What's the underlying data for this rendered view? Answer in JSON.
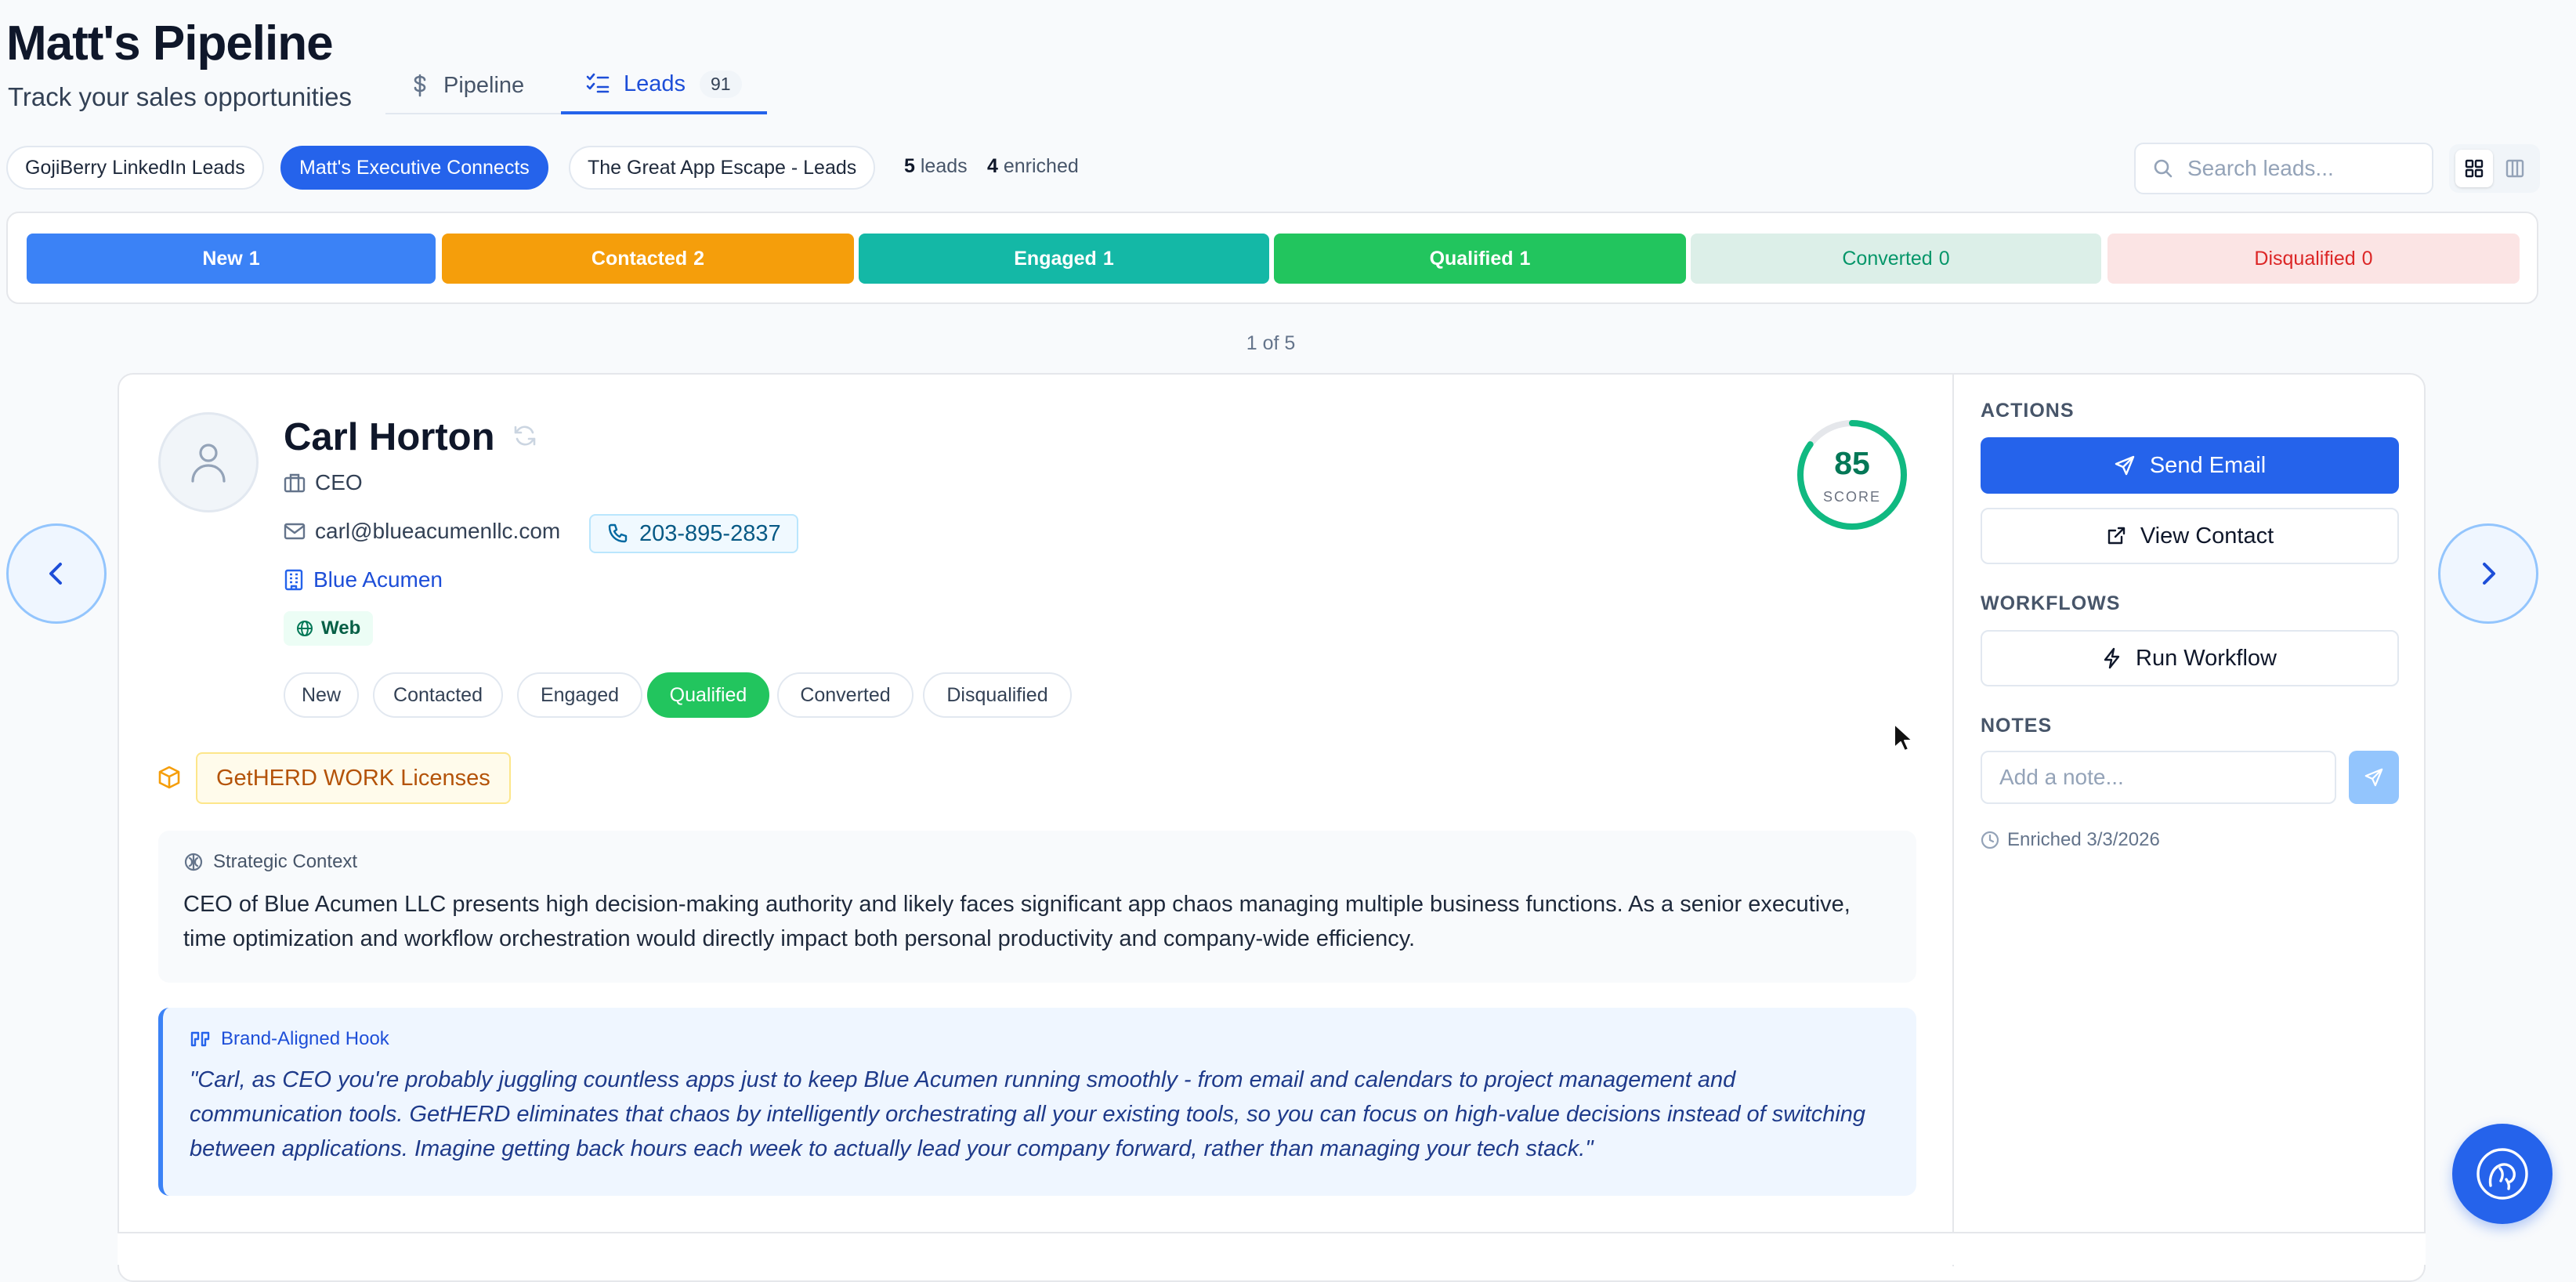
{
  "header": {
    "title": "Matt's Pipeline",
    "subtitle": "Track your sales opportunities",
    "tabs": [
      {
        "label": "Pipeline",
        "icon": "dollar-icon"
      },
      {
        "label": "Leads",
        "icon": "list-check-icon",
        "badge": "91"
      }
    ]
  },
  "filters": {
    "chips": [
      "GojiBerry LinkedIn Leads",
      "Matt's Executive Connects",
      "The Great App Escape - Leads"
    ],
    "active_chip": "Matt's Executive Connects",
    "leads_count": "5",
    "leads_label": "leads",
    "enriched_count": "4",
    "enriched_label": "enriched",
    "search_placeholder": "Search leads..."
  },
  "stages": [
    {
      "label": "New",
      "count": "1",
      "color": "#3b82f6"
    },
    {
      "label": "Contacted",
      "count": "2",
      "color": "#f59e0b"
    },
    {
      "label": "Engaged",
      "count": "1",
      "color": "#14b8a6"
    },
    {
      "label": "Qualified",
      "count": "1",
      "color": "#22c55e"
    },
    {
      "label": "Converted",
      "count": "0",
      "color": "#dcefe8"
    },
    {
      "label": "Disqualified",
      "count": "0",
      "color": "#fbe4e4"
    }
  ],
  "pagination": "1 of 5",
  "lead": {
    "name": "Carl Horton",
    "title": "CEO",
    "email": "carl@blueacumenllc.com",
    "phone": "203-895-2837",
    "company": "Blue Acumen",
    "source": "Web",
    "score": "85",
    "score_label": "SCORE",
    "score_fraction": 0.85,
    "status_options": [
      "New",
      "Contacted",
      "Engaged",
      "Qualified",
      "Converted",
      "Disqualified"
    ],
    "current_status": "Qualified",
    "product": "GetHERD WORK Licenses",
    "strategic_context_title": "Strategic Context",
    "strategic_context": "CEO of Blue Acumen LLC presents high decision-making authority and likely faces significant app chaos managing multiple business functions. As a senior executive, time optimization and workflow orchestration would directly impact both personal productivity and company-wide efficiency.",
    "hook_title": "Brand-Aligned Hook",
    "hook": "\"Carl, as CEO you're probably juggling countless apps just to keep Blue Acumen running smoothly - from email and calendars to project management and communication tools. GetHERD eliminates that chaos by intelligently orchestrating all your existing tools, so you can focus on high-value decisions instead of switching between applications. Imagine getting back hours each week to actually lead your company forward, rather than managing your tech stack.\""
  },
  "panel": {
    "actions_label": "ACTIONS",
    "send_email": "Send Email",
    "view_contact": "View Contact",
    "workflows_label": "WORKFLOWS",
    "run_workflow": "Run Workflow",
    "notes_label": "NOTES",
    "note_placeholder": "Add a note...",
    "enriched": "Enriched 3/3/2026"
  },
  "colors": {
    "accent": "#2563eb",
    "score": "#10b981",
    "qualified": "#22c55e"
  }
}
